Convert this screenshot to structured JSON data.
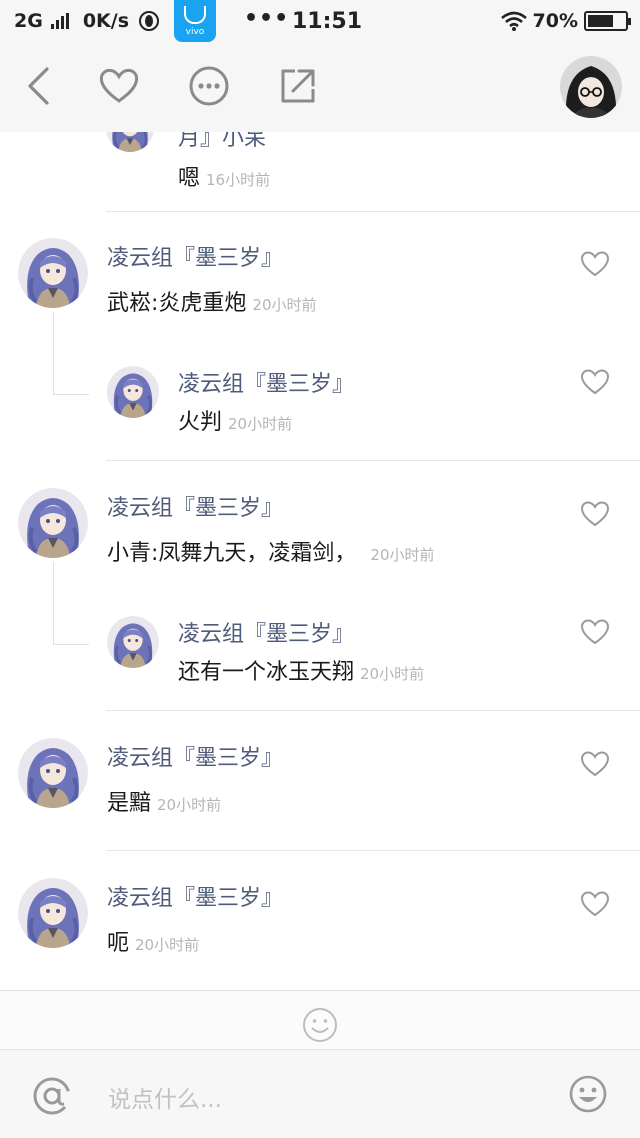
{
  "status_bar": {
    "network": "2G",
    "speed": "0K/s",
    "app_badge": "vivo",
    "dots": "•••",
    "time": "11:51",
    "battery": "70%",
    "battery_level": 0.7
  },
  "header": {
    "icons": [
      "back-icon",
      "like-icon",
      "more-icon",
      "share-icon"
    ]
  },
  "comments": [
    {
      "name": "月』小呆",
      "text": "嗯",
      "time": "16小时前"
    },
    {
      "name": "凌云组『墨三岁』",
      "text": "武崧:炎虎重炮",
      "time": "20小时前"
    },
    {
      "name": "凌云组『墨三岁』",
      "text": "火判",
      "time": "20小时前"
    },
    {
      "name": "凌云组『墨三岁』",
      "text": "小青:凤舞九天，凌霜剑，",
      "time": "20小时前"
    },
    {
      "name": "凌云组『墨三岁』",
      "text": "还有一个冰玉天翔",
      "time": "20小时前"
    },
    {
      "name": "凌云组『墨三岁』",
      "text": "是黯",
      "time": "20小时前"
    },
    {
      "name": "凌云组『墨三岁』",
      "text": "呃",
      "time": "20小时前"
    }
  ],
  "input": {
    "placeholder": "说点什么..."
  },
  "colors": {
    "name": "#4f5b7a",
    "time": "#b5b5b5",
    "toolbar_icon": "#8a8a8a",
    "vivo": "#1aa3f0"
  }
}
